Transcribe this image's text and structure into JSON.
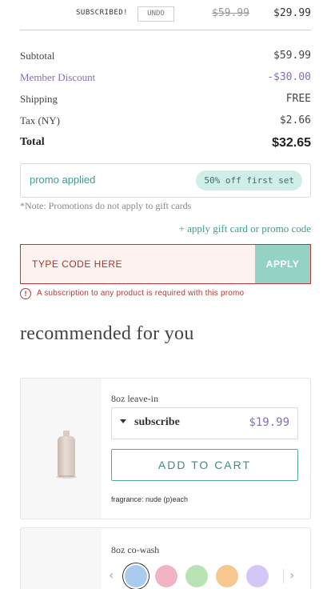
{
  "top": {
    "subscribed_label": "SUBSCRIBED!",
    "undo_label": "UNDO",
    "price_old": "$59.99",
    "price_new": "$29.99"
  },
  "summary": {
    "rows": [
      {
        "label": "Subtotal",
        "value": "$59.99"
      },
      {
        "label": "Member Discount",
        "value": "-$30.00"
      },
      {
        "label": "Shipping",
        "value": "FREE"
      },
      {
        "label": "Tax (NY)",
        "value": "$2.66"
      },
      {
        "label": "Total",
        "value": "$32.65"
      }
    ]
  },
  "promo": {
    "status": "promo applied",
    "badge": "50% off first set",
    "note": "*Note: Promotions do not apply to gift cards",
    "apply_link": "+ apply gift card or promo code",
    "input_placeholder": "TYPE CODE HERE",
    "apply_button": "APPLY",
    "error_icon": "!",
    "error": "A subscription to any product is required with this promo"
  },
  "recommended": {
    "title": "recommended for you",
    "products": [
      {
        "name": "8oz leave-in",
        "image_icon": "bottle-icon",
        "option": "subscribe",
        "price": "$19.99",
        "add_to_cart": "ADD TO CART",
        "fragrance": "fragrance: nude (p)each"
      },
      {
        "name": "8oz co-wash",
        "swatches": [
          "#a9cbee",
          "#f2b4c2",
          "#b8e3b5",
          "#f8c68f",
          "#d3c7f5"
        ],
        "prev_icon": "‹",
        "next_icon": "›"
      }
    ]
  },
  "colors": {
    "accent_teal": "#3f9c8f",
    "discount_purple": "#8a6bb8",
    "error_red": "#b23b3b",
    "apply_button_bg": "#94d2c6"
  }
}
